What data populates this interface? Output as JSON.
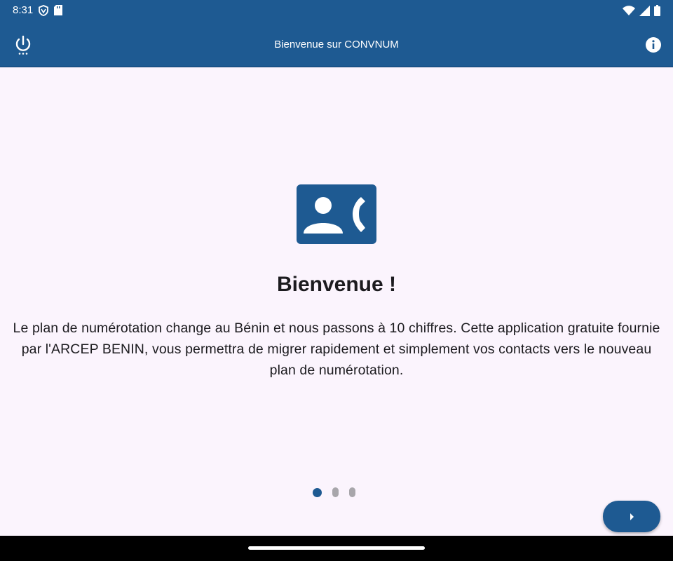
{
  "status_bar": {
    "time": "8:31",
    "icons": [
      "vpn-shield-icon",
      "sd-card-icon",
      "wifi-icon",
      "signal-icon",
      "battery-icon"
    ]
  },
  "app_bar": {
    "title": "Bienvenue sur CONVNUM",
    "left_icon": "power-icon",
    "right_icon": "info-icon",
    "color": "#1e5a92"
  },
  "onboarding": {
    "icon": "contact-phone-icon",
    "title": "Bienvenue !",
    "body": "Le plan de numérotation change au Bénin et nous passons à 10 chiffres. Cette application gratuite fournie par l'ARCEP BENIN, vous permettra de migrer rapidement et simplement vos contacts vers le nouveau plan de numérotation.",
    "page_count": 3,
    "current_page": 1,
    "next_icon": "arrow-right-icon"
  }
}
